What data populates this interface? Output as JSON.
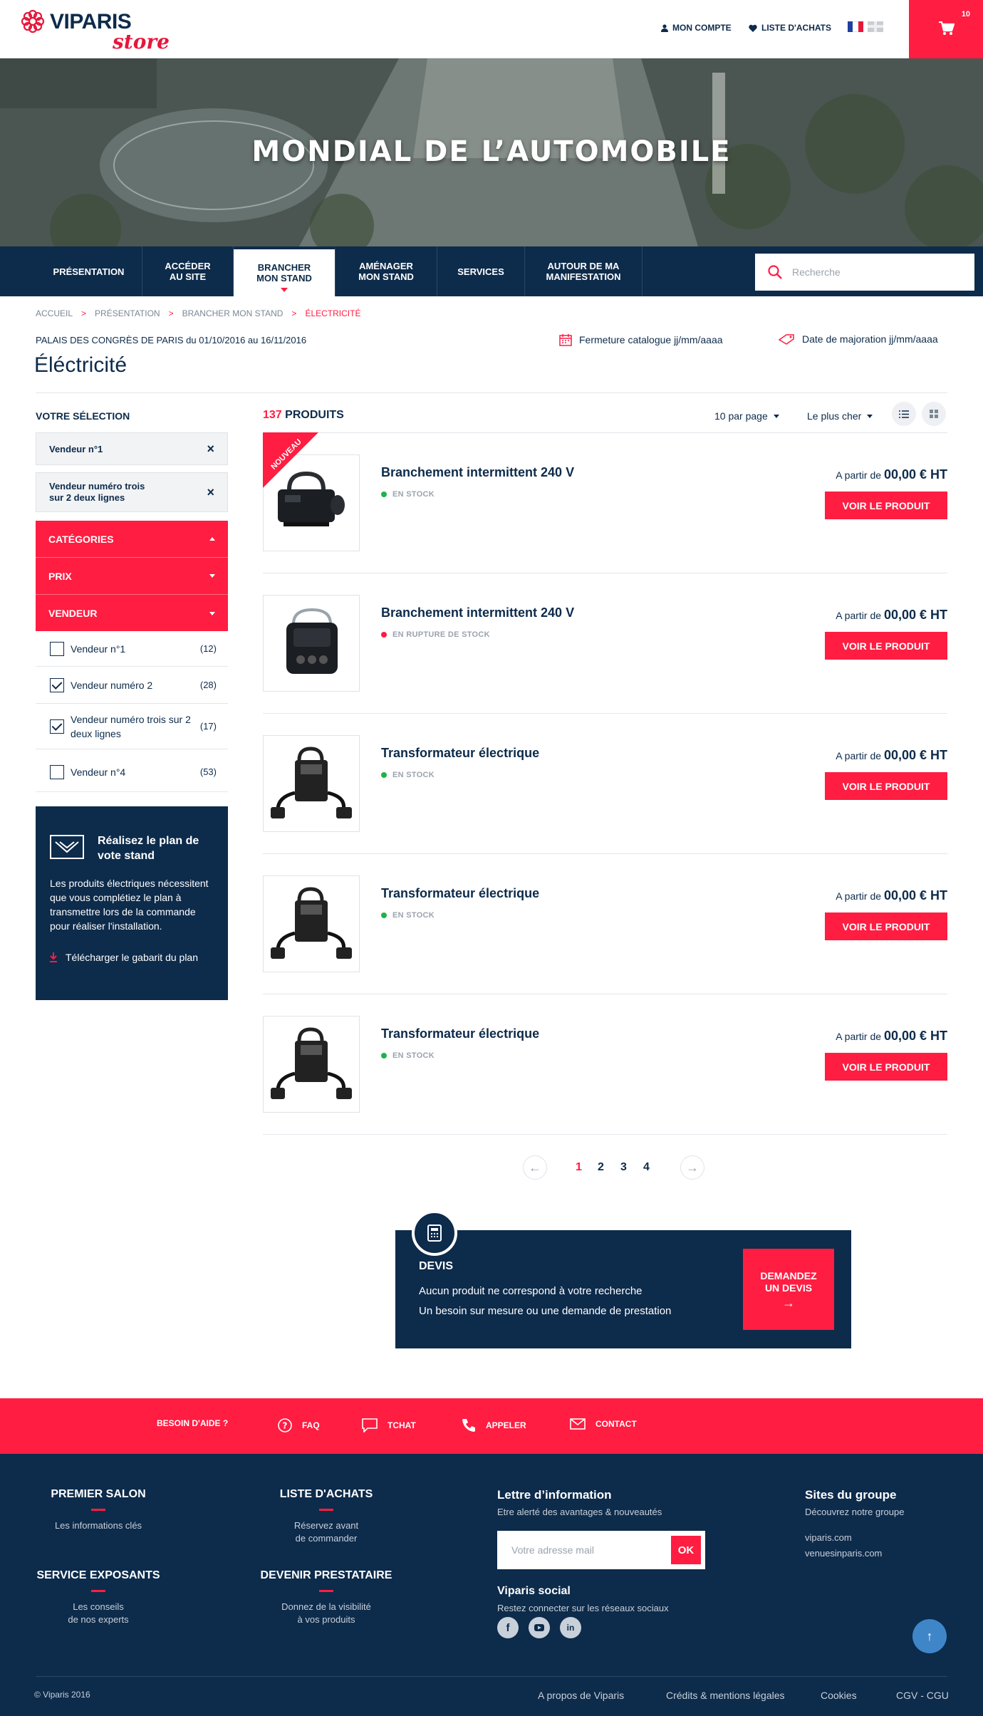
{
  "header": {
    "logo_word": "VIPARIS",
    "logo_store": "store",
    "account": "MON COMPTE",
    "wishlist": "LISTE D'ACHATS",
    "cart_count": "10",
    "colors": {
      "brand": "#ff1d42",
      "navy": "#0d2b4b"
    }
  },
  "hero": {
    "title": "MONDIAL DE L’AUTOMOBILE"
  },
  "nav": {
    "items": [
      {
        "label": "PRÉSENTATION"
      },
      {
        "label": "ACCÉDER\nAU SITE"
      },
      {
        "label": "BRANCHER\nMON STAND"
      },
      {
        "label": "AMÉNAGER\nMON STAND"
      },
      {
        "label": "SERVICES"
      },
      {
        "label": "AUTOUR DE MA\nMANIFESTATION"
      }
    ],
    "active_index": 2,
    "search_placeholder": "Recherche"
  },
  "breadcrumb": [
    "ACCUEIL",
    "PRÉSENTATION",
    "BRANCHER MON STAND",
    "ÉLECTRICITÉ"
  ],
  "event": {
    "venue": "PALAIS DES CONGRÈS DE PARIS  du 01/10/2016 au 16/11/2016",
    "closing": "Fermeture catalogue  jj/mm/aaaa",
    "surcharge": "Date de majoration jj/mm/aaaa"
  },
  "page_title": "Éléctricité",
  "sidebar": {
    "selection_title": "VOTRE SÉLECTION",
    "chips": [
      "Vendeur n°1",
      "Vendeur numéro trois\nsur 2 deux lignes"
    ],
    "filters": [
      "CATÉGORIES",
      "PRIX",
      "VENDEUR"
    ],
    "vendors": [
      {
        "name": "Vendeur n°1",
        "count": "(12)",
        "checked": false
      },
      {
        "name": "Vendeur numéro 2",
        "count": "(28)",
        "checked": true
      },
      {
        "name": "Vendeur numéro trois sur 2 deux lignes",
        "count": "(17)",
        "checked": true
      },
      {
        "name": "Vendeur n°4",
        "count": "(53)",
        "checked": false
      }
    ],
    "plan": {
      "title": "Réalisez le plan de vote stand",
      "text": "Les produits électriques nécessitent que vous complétiez le plan à transmettre lors de la commande pour réaliser l'installation.",
      "link": "Télécharger le gabarit du plan"
    }
  },
  "listing": {
    "count": "137",
    "count_label": "PRODUITS",
    "per_page": "10 par page",
    "sort": "Le plus cher",
    "badge": "NOUVEAU",
    "price_prefix": "A partir de",
    "button": "VOIR LE PRODUIT",
    "products": [
      {
        "name": "Branchement intermittent 240 V",
        "stock": "EN STOCK",
        "in_stock": true,
        "price": "00,00 € HT",
        "image": "fog-machine-icon"
      },
      {
        "name": "Branchement intermittent 240 V",
        "stock": "EN RUPTURE DE STOCK",
        "in_stock": false,
        "price": "00,00 € HT",
        "image": "fog-machine-front-icon"
      },
      {
        "name": "Transformateur électrique",
        "stock": "EN STOCK",
        "in_stock": true,
        "price": "00,00 € HT",
        "image": "transformer-icon"
      },
      {
        "name": "Transformateur électrique",
        "stock": "EN STOCK",
        "in_stock": true,
        "price": "00,00 € HT",
        "image": "transformer-icon"
      },
      {
        "name": "Transformateur électrique",
        "stock": "EN STOCK",
        "in_stock": true,
        "price": "00,00 € HT",
        "image": "transformer-icon"
      }
    ],
    "pages": [
      "1",
      "2",
      "3",
      "4"
    ],
    "current_page": "1"
  },
  "devis": {
    "title": "DEVIS",
    "line1": "Aucun produit ne correspond à votre recherche",
    "line2": "Un besoin sur mesure ou une demande de prestation",
    "button": "DEMANDEZ\nUN DEVIS"
  },
  "help": {
    "title": "BESOIN D'AIDE ?",
    "items": [
      "FAQ",
      "TCHAT",
      "APPELER",
      "CONTACT"
    ]
  },
  "footer": {
    "cols": [
      {
        "title": "PREMIER SALON",
        "text": "Les informations clés"
      },
      {
        "title": "LISTE D'ACHATS",
        "text": "Réservez avant\nde commander"
      },
      {
        "title": "SERVICE EXPOSANTS",
        "text": "Les conseils\nde nos experts"
      },
      {
        "title": "DEVENIR PRESTATAIRE",
        "text": "Donnez de la visibilité\nà vos produits"
      }
    ],
    "newsletter": {
      "title": "Lettre d’information",
      "subtitle": "Etre alerté des avantages & nouveautés",
      "placeholder": "Votre adresse mail",
      "ok": "OK"
    },
    "social": {
      "title": "Viparis social",
      "subtitle": "Restez connecter sur les réseaux sociaux"
    },
    "sites": {
      "title": "Sites du groupe",
      "subtitle": "Découvrez notre groupe",
      "links": [
        "viparis.com",
        "venuesinparis.com"
      ]
    },
    "copyright": "© Viparis 2016",
    "bottom_links": [
      "A propos de Viparis",
      "Crédits & mentions légales",
      "Cookies",
      "CGV - CGU"
    ]
  }
}
